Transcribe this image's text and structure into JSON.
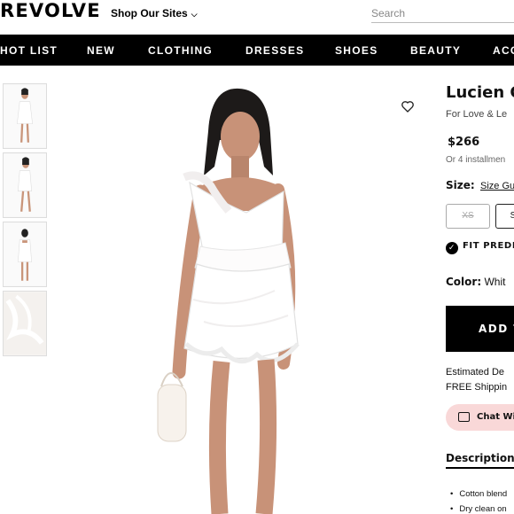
{
  "header": {
    "logo": "REVOLVE",
    "shop_sites": "Shop Our Sites",
    "search_placeholder": "Search"
  },
  "nav": {
    "items": [
      "HOT LIST",
      "NEW",
      "CLOTHING",
      "DRESSES",
      "SHOES",
      "BEAUTY",
      "ACC"
    ]
  },
  "product": {
    "name": "Lucien C",
    "brand": "For Love & Le",
    "price": "$266",
    "installments": "Or 4 installmen",
    "size_label": "Size:",
    "size_guide": "Size Gu",
    "sizes": [
      "XS",
      "S"
    ],
    "fit_predictor": "FIT PREDIC",
    "color_label": "Color:",
    "color_value": "Whit",
    "add_button": "ADD T",
    "shipping_line1": "Estimated De",
    "shipping_line2": "FREE Shippin",
    "chat": "Chat Wi",
    "description_tab": "Description",
    "bullets": [
      "Cotton blend",
      "Dry clean on"
    ]
  },
  "colors": {
    "nav_bg": "#000000",
    "chat_bg": "#f9d8d8",
    "dress": "#ffffff"
  },
  "icons": [
    "chevron-down-icon",
    "heart-icon",
    "fit-predictor-icon",
    "chat-icon"
  ]
}
